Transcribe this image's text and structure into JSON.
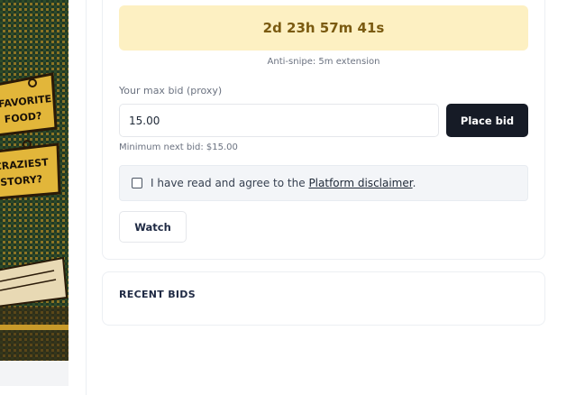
{
  "auction": {
    "countdown": "2d 23h 57m 41s",
    "antisnipe_note": "Anti-snipe: 5m extension"
  },
  "bid_form": {
    "label": "Your max bid (proxy)",
    "value": "15.00",
    "place_bid_label": "Place bid",
    "min_next_bid": "Minimum next bid: $15.00"
  },
  "disclaimer": {
    "prefix": "I have read and agree to the ",
    "link_text": "Platform disclaimer",
    "suffix": ".",
    "checked": false
  },
  "watch_label": "Watch",
  "recent_bids": {
    "title": "RECENT BIDS"
  },
  "product_image": {
    "caption_lines": [
      "FAVORITE",
      "FOOD?",
      "CRAZIEST",
      "STORY?"
    ]
  },
  "colors": {
    "countdown_bg": "#fdf0c2",
    "countdown_text": "#7a5a10",
    "primary_button": "#161b26"
  }
}
